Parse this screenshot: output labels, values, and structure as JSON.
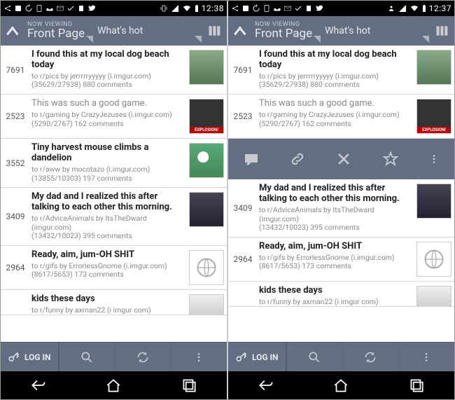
{
  "left": {
    "clock": "12:38",
    "header": {
      "nowviewing": "NOW VIEWING",
      "page": "Front Page",
      "whats": "What's hot"
    },
    "posts": [
      {
        "score": "7691",
        "title": "I found this at my local dog beach today",
        "meta1": "to r/pics by jerrrrryyyyy (i.imgur.com)",
        "meta2": "(35629/27938) 880 comments"
      },
      {
        "score": "2523",
        "title": "This was such a good game.",
        "meta1": "to r/gaming by CrazyJezuses (i.imgur.com)",
        "meta2": "(5290/2767) 162 comments"
      },
      {
        "score": "3552",
        "title": "Tiny harvest mouse climbs a dandelion",
        "meta1": "to r/aww by mocotazo (i.imgur.com)",
        "meta2": "(13855/10303) 197 comments"
      },
      {
        "score": "3409",
        "title": "My dad and I realized this after talking to each other this morning.",
        "meta1": "to r/AdviceAnimals by ItsTheDward (imgur.com)",
        "meta2": "(13432/10023) 395 comments"
      },
      {
        "score": "2964",
        "title": "Ready, aim, jum-OH SHIT",
        "meta1": "to r/gifs by ErrorlessGnome (i.imgur.com)",
        "meta2": "(8617/5653) 173 comments"
      },
      {
        "score": "",
        "title": "kids these days",
        "meta1": "to r/funny by axman22 (i imgur com)",
        "meta2": ""
      }
    ],
    "toolbar": {
      "login": "LOG IN"
    }
  },
  "right": {
    "clock": "12:37",
    "header": {
      "nowviewing": "NOW VIEWING",
      "page": "Front Page",
      "whats": "What's hot"
    },
    "posts": [
      {
        "score": "7691",
        "title": "I found this at my local dog beach today",
        "meta1": "to r/pics by jerrrrryyyyy (i.imgur.com)",
        "meta2": "(35629/27938) 880 comments"
      },
      {
        "score": "2523",
        "title": "This was such a good game.",
        "meta1": "to r/gaming by CrazyJezuses (i.imgur.com)",
        "meta2": "(5290/2767) 162 comments"
      },
      {
        "score": "3409",
        "title": "My dad and I realized this after talking to each other this morning.",
        "meta1": "to r/AdviceAnimals by ItsTheDward (imgur.com)",
        "meta2": "(13432/10023) 395 comments"
      },
      {
        "score": "2964",
        "title": "Ready, aim, jum-OH SHIT",
        "meta1": "to r/gifs by ErrorlessGnome (i.imgur.com)",
        "meta2": "(8617/5653) 173 comments"
      },
      {
        "score": "",
        "title": "kids these days",
        "meta1": "to r/funny by axman22 (i imgur com)",
        "meta2": ""
      }
    ],
    "toolbar": {
      "login": "LOG IN"
    }
  }
}
